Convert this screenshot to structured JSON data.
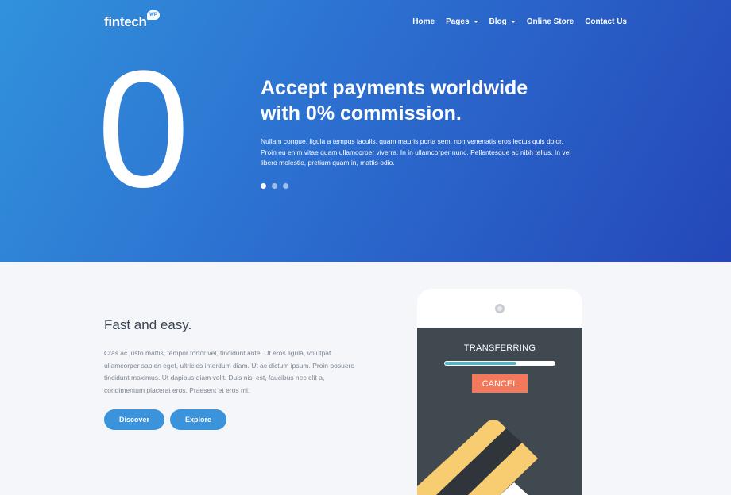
{
  "header": {
    "logo_text": "fintech",
    "logo_badge": "WP",
    "nav": [
      {
        "label": "Home",
        "has_caret": false
      },
      {
        "label": "Pages",
        "has_caret": true
      },
      {
        "label": "Blog",
        "has_caret": true
      },
      {
        "label": "Online Store",
        "has_caret": false
      },
      {
        "label": "Contact Us",
        "has_caret": false
      }
    ]
  },
  "hero": {
    "big_number": "0",
    "title_line1": "Accept payments worldwide",
    "title_line2": "with 0% commission.",
    "text": "Nullam congue, ligula a tempus iaculis, quam mauris porta sem, non venenatis eros lectus quis dolor. Proin eu enim vitae quam ullamcorper viverra. In in ullamcorper nunc. Pellentesque ac nibh tellus. In vel libero molestie, pretium quam in, mattis odio.",
    "slider_dots": 3,
    "active_dot": 0
  },
  "feature": {
    "title": "Fast and easy.",
    "text": "Cras ac justo mattis, tempor tortor vel, tincidunt ante. Ut eros ligula, volutpat ullamcorper sapien eget, ultricies interdum diam. Ut ac dictum ipsum. Proin posuere tincidunt maximus. Ut dapibus diam velit. Duis nisl est, faucibus nec elit a, condimentum placerat eros. Praesent et eros mi.",
    "discover_label": "Discover",
    "explore_label": "Explore"
  },
  "phone": {
    "status_text": "TRANSFERRING",
    "progress": 0.65,
    "cancel_label": "CANCEL"
  },
  "colors": {
    "hero_start": "#3192dc",
    "hero_end": "#2447b8",
    "button": "#3a93db",
    "cancel": "#f4795a",
    "progress_fill": "#5bb2c1",
    "phone_screen": "#414950"
  }
}
